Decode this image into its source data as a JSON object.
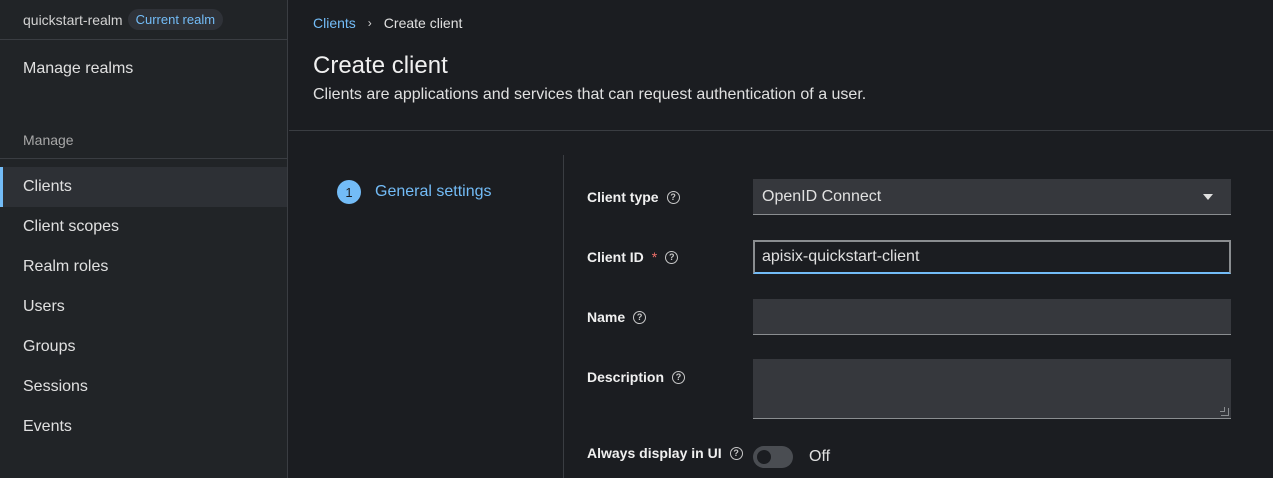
{
  "realm": {
    "name": "quickstart-realm",
    "badge": "Current realm"
  },
  "sidebar": {
    "manage_realms": "Manage realms",
    "section_label": "Manage",
    "items": [
      {
        "label": "Clients",
        "active": true
      },
      {
        "label": "Client scopes"
      },
      {
        "label": "Realm roles"
      },
      {
        "label": "Users"
      },
      {
        "label": "Groups"
      },
      {
        "label": "Sessions"
      },
      {
        "label": "Events"
      }
    ]
  },
  "breadcrumb": {
    "parent": "Clients",
    "separator": "›",
    "current": "Create client"
  },
  "page": {
    "title": "Create client",
    "description": "Clients are applications and services that can request authentication of a user."
  },
  "wizard": {
    "step_number": "1",
    "step_label": "General settings"
  },
  "form": {
    "client_type": {
      "label": "Client type",
      "value": "OpenID Connect"
    },
    "client_id": {
      "label": "Client ID",
      "required_mark": "*",
      "value": "apisix-quickstart-client"
    },
    "name": {
      "label": "Name",
      "value": ""
    },
    "description": {
      "label": "Description",
      "value": ""
    },
    "always_display": {
      "label": "Always display in UI",
      "state": "Off"
    }
  },
  "icons": {
    "help": "question-circle-icon",
    "caret": "caret-down-icon"
  },
  "colors": {
    "accent": "#73bcf7",
    "required": "#f0706a",
    "background": "#1b1d21"
  }
}
